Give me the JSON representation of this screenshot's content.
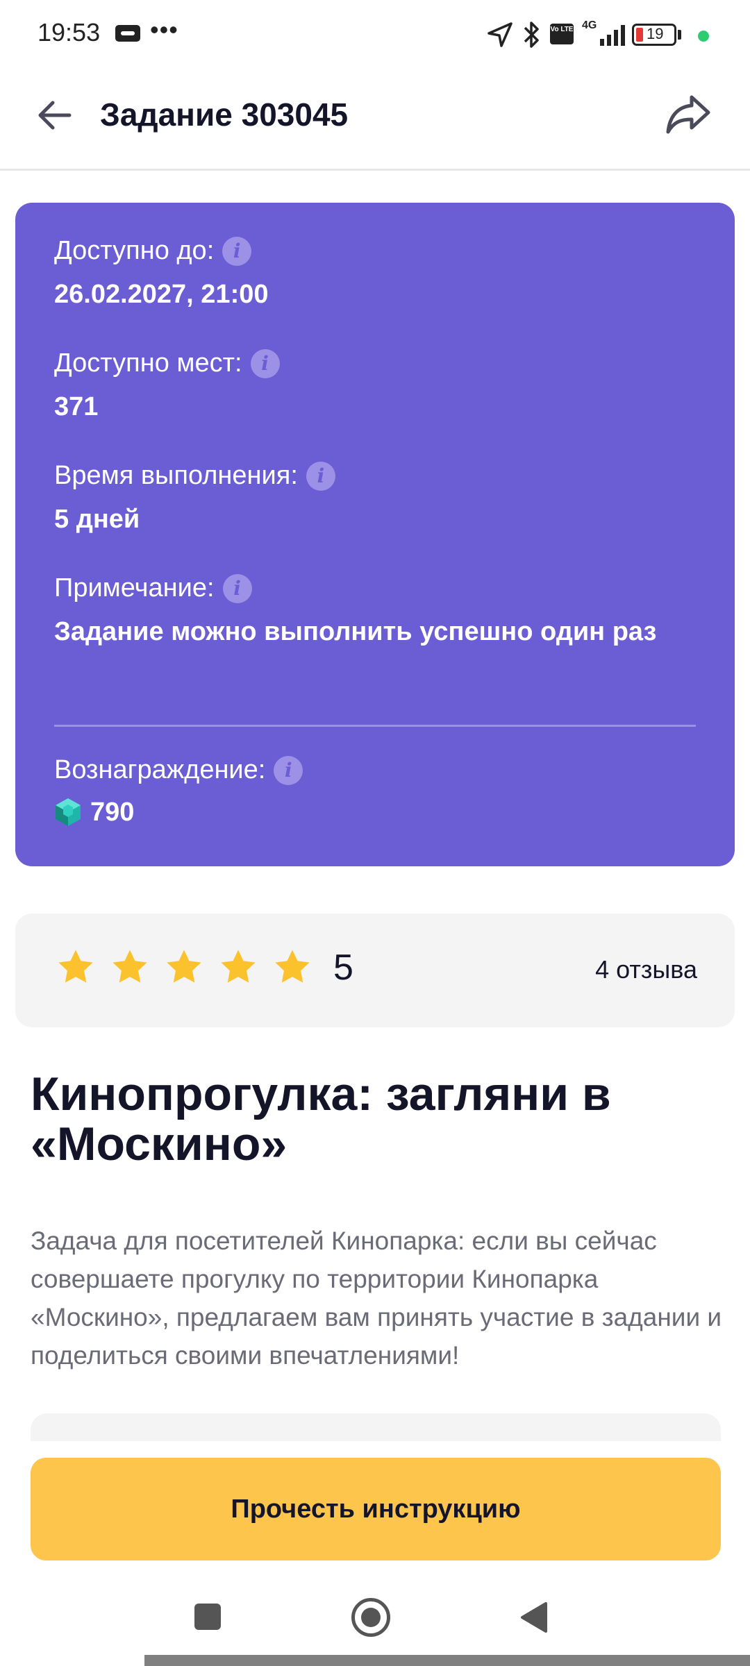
{
  "status_bar": {
    "time": "19:53",
    "dots": "•••",
    "network": "4G",
    "volte": "Vo LTE",
    "battery": "19",
    "icons": [
      "call-icon",
      "location-icon",
      "bluetooth-icon",
      "volte-icon",
      "signal-icon",
      "battery-icon"
    ]
  },
  "header": {
    "title": "Задание 303045",
    "back_icon": "arrow-left-icon",
    "share_icon": "share-icon"
  },
  "info": {
    "available_until_label": "Доступно до:",
    "available_until_value": "26.02.2027, 21:00",
    "places_label": "Доступно мест:",
    "places_value": "371",
    "duration_label": "Время выполнения:",
    "duration_value": "5 дней",
    "note_label": "Примечание:",
    "note_value": "Задание можно выполнить успешно один раз",
    "reward_label": "Вознаграждение:",
    "reward_value": "790",
    "info_icon_glyph": "i",
    "card_color": "#6b5dd3"
  },
  "rating": {
    "stars": 5,
    "value": "5",
    "reviews": "4 отзыва"
  },
  "task": {
    "title": "Кинопрогулка: загляни в «Москино»",
    "description": "Задача для посетителей Кинопарка: если вы сейчас совершаете прогулку по территории Кинопарка «Москино», предлагаем вам принять участие в задании и поделиться своими впечатлениями!"
  },
  "actions": {
    "read_instructions": "Прочесть инструкцию",
    "button_color": "#fdc54c"
  },
  "nav": {
    "icons": [
      "recent-apps-icon",
      "home-icon",
      "back-icon"
    ]
  }
}
